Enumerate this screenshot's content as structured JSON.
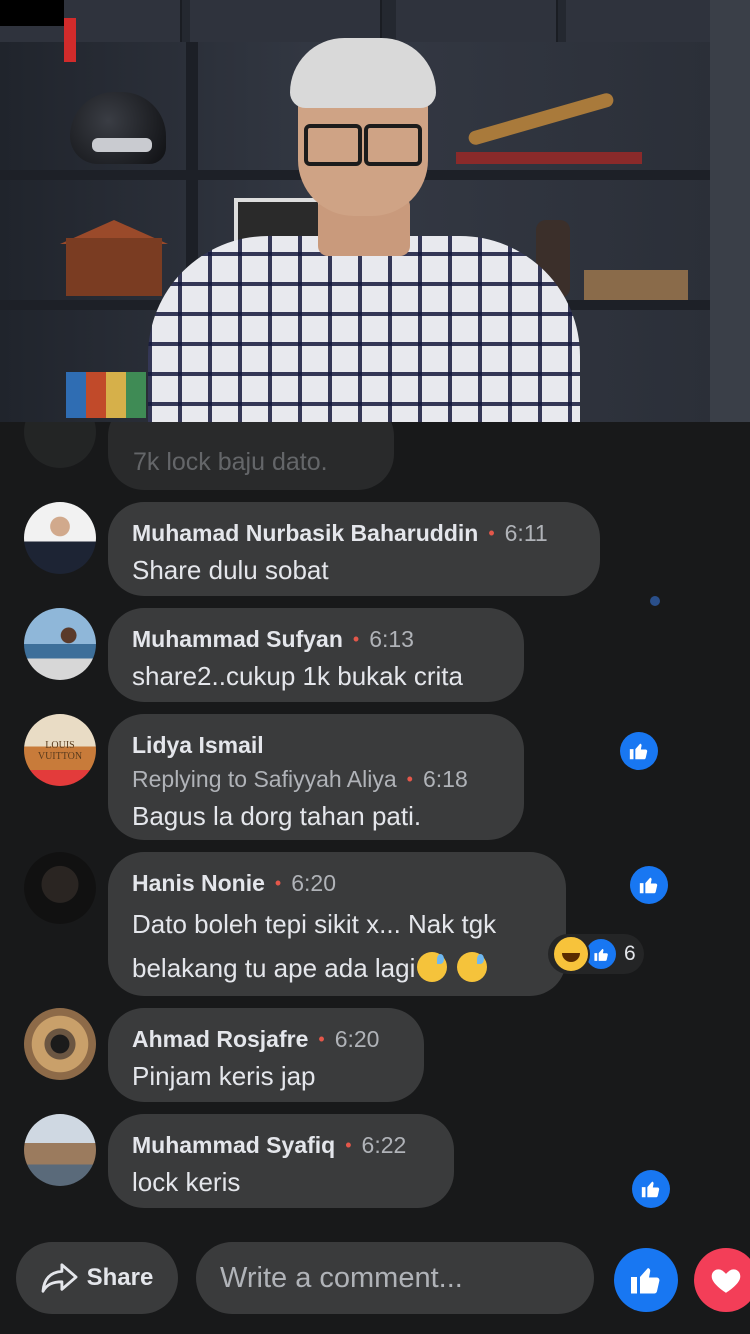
{
  "video": {
    "description_hidden": ""
  },
  "faded_comment": {
    "text": "7k lock baju dato."
  },
  "comments": [
    {
      "name": "Muhamad Nurbasik Baharuddin",
      "time": "6:11",
      "lines": [
        "Share dulu sobat"
      ]
    },
    {
      "name": "Muhammad Sufyan",
      "time": "6:13",
      "lines": [
        "share2..cukup 1k bukak crita"
      ]
    },
    {
      "name": "Lidya Ismail",
      "reply": "Replying to Safiyyah Aliya",
      "time": "6:18",
      "lines": [
        "Bagus la dorg tahan pati."
      ],
      "avatar_text": "LOUIS VUITTON"
    },
    {
      "name": "Hanis Nonie",
      "time": "6:20",
      "lines": [
        "Dato boleh tepi sikit x... Nak tgk",
        "belakang tu ape ada lagi"
      ],
      "reaction_count": "6"
    },
    {
      "name": "Ahmad Rosjafre",
      "time": "6:20",
      "lines": [
        "Pinjam keris jap"
      ]
    },
    {
      "name": "Muhammad Syafiq",
      "time": "6:22",
      "lines": [
        "lock keris"
      ]
    }
  ],
  "bottom_bar": {
    "share_label": "Share",
    "comment_placeholder": "Write a comment..."
  },
  "icons": {
    "share": "share-arrow-icon",
    "like": "thumbs-up-icon",
    "love": "heart-icon",
    "haha": "haha-emoji-icon",
    "sweat": "sweat-smile-emoji-icon"
  },
  "colors": {
    "background": "#18191a",
    "bubble": "#3a3b3c",
    "accent_blue": "#1877f2",
    "love_red": "#f33e58",
    "dot_red": "#e4574a"
  }
}
